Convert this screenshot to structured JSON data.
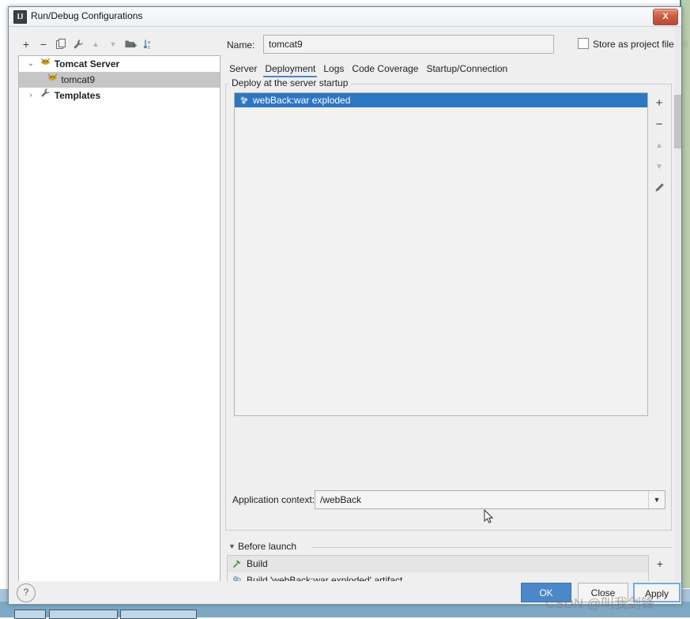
{
  "window": {
    "title": "Run/Debug Configurations",
    "icon": "intellij-idea-icon",
    "close_label": "X"
  },
  "left_toolbar": {
    "buttons": [
      {
        "name": "add-configuration-button",
        "glyph": "+",
        "enabled": true
      },
      {
        "name": "remove-configuration-button",
        "glyph": "−",
        "enabled": true
      },
      {
        "name": "copy-configuration-button",
        "glyph": "copy-icon",
        "enabled": true
      },
      {
        "name": "edit-templates-button",
        "glyph": "wrench-icon",
        "enabled": true
      },
      {
        "name": "move-up-button",
        "glyph": "▲",
        "enabled": false
      },
      {
        "name": "move-down-button",
        "glyph": "▼",
        "enabled": false
      },
      {
        "name": "new-folder-button",
        "glyph": "folder-add-icon",
        "enabled": true
      },
      {
        "name": "sort-configurations-button",
        "glyph": "sort-az-icon",
        "enabled": true
      }
    ]
  },
  "tree": {
    "nodes": [
      {
        "label": "Tomcat Server",
        "icon": "tomcat-icon",
        "twisty": "⌄",
        "expanded": true,
        "level": 0,
        "selected": false,
        "bold": true
      },
      {
        "label": "tomcat9",
        "icon": "tomcat-icon",
        "twisty": "",
        "expanded": false,
        "level": 1,
        "selected": true,
        "bold": false
      },
      {
        "label": "Templates",
        "icon": "wrench-icon",
        "twisty": "›",
        "expanded": false,
        "level": 0,
        "selected": false,
        "bold": true
      }
    ]
  },
  "name_row": {
    "label": "Name:",
    "value": "tomcat9",
    "placeholder": "",
    "store_as_project_file_label": "Store as project file",
    "store_as_project_file_checked": false,
    "gear_icon": "gear-icon"
  },
  "tabs": [
    {
      "label": "Server",
      "active": false
    },
    {
      "label": "Deployment",
      "active": true
    },
    {
      "label": "Logs",
      "active": false
    },
    {
      "label": "Code Coverage",
      "active": false
    },
    {
      "label": "Startup/Connection",
      "active": false
    }
  ],
  "deployment": {
    "group_title": "Deploy at the server startup",
    "items": [
      {
        "label": "webBack:war exploded",
        "icon": "artifact-icon",
        "selected": true
      }
    ],
    "side_buttons": [
      {
        "name": "add-artifact-button",
        "glyph": "+",
        "enabled": true
      },
      {
        "name": "remove-artifact-button",
        "glyph": "−",
        "enabled": true
      },
      {
        "name": "move-artifact-up-button",
        "glyph": "▲",
        "enabled": false
      },
      {
        "name": "move-artifact-down-button",
        "glyph": "▼",
        "enabled": false
      },
      {
        "name": "edit-artifact-button",
        "glyph": "pencil-icon",
        "enabled": true
      }
    ],
    "application_context": {
      "label": "Application context:",
      "value": "/webBack",
      "arrow": "▼"
    }
  },
  "before_launch": {
    "title": "Before launch",
    "twisty": "▼",
    "items": [
      {
        "label": "Build",
        "icon": "build-hammer-icon"
      },
      {
        "label": "Build 'webBack:war exploded' artifact",
        "icon": "artifact-icon"
      }
    ],
    "side_buttons": [
      {
        "name": "add-before-launch-task-button",
        "glyph": "+",
        "enabled": true
      },
      {
        "name": "remove-before-launch-task-button",
        "glyph": "−",
        "enabled": false
      }
    ]
  },
  "footer": {
    "help_label": "?",
    "ok_label": "OK",
    "close_label": "Close",
    "apply_label": "Apply"
  },
  "watermark": {
    "text": "CSDN @叫我剑锋"
  },
  "colors": {
    "accent_blue": "#4a88c7",
    "selection_blue": "#2c76c4",
    "dialog_bg": "#efefef",
    "tree_selection_gray": "#c6c6c6",
    "close_red": "#cb5c43"
  }
}
